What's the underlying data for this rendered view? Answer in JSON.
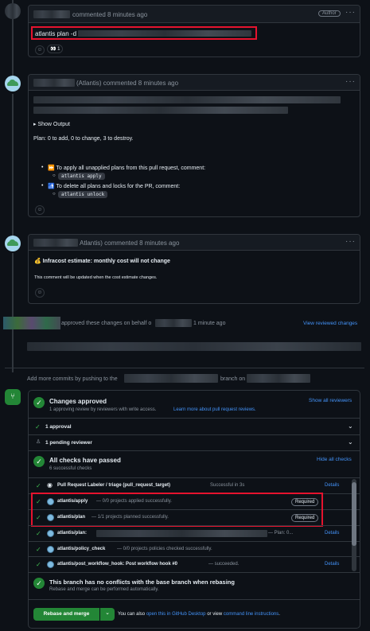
{
  "comment1": {
    "header_suffix": "commented 8 minutes ago",
    "author_badge": "Author",
    "body_prefix": "atlantis plan -d",
    "reaction_count": "1"
  },
  "comment2": {
    "header_suffix": "(Atlantis) commented 8 minutes ago",
    "show_output": "▸ Show Output",
    "plan_summary": "Plan: 0 to add, 0 to change, 3 to destroy.",
    "bullet1": "⏩ To apply all unapplied plans from this pull request, comment:",
    "code1": "atlantis apply",
    "bullet2": "🚮 To delete all plans and locks for the PR, comment:",
    "code2": "atlantis unlock"
  },
  "comment3": {
    "header_suffix": "Atlantis) commented 8 minutes ago",
    "estimate": "💰 Infracost estimate: monthly cost will not change",
    "note": "This comment will be updated when the cost estimate changes."
  },
  "approval_event": {
    "text_a": "approved these changes on behalf o",
    "text_b": "1 minute ago",
    "link": "View reviewed changes"
  },
  "push_hint": {
    "prefix": "Add more commits by pushing to the",
    "middle": "branch on"
  },
  "merge_box": {
    "approved": {
      "title": "Changes approved",
      "desc": "1 approving review by reviewers with write access.",
      "desc_link": "Learn more about pull request reviews.",
      "show_all": "Show all reviewers"
    },
    "approval_row": "1 approval",
    "pending_row": "1 pending reviewer",
    "checks": {
      "title": "All checks have passed",
      "desc": "6 successful checks",
      "hide_all": "Hide all checks"
    },
    "check_rows": [
      {
        "name": "Pull Request Labeler / triage (pull_request_target)",
        "status": "Successful in 3s",
        "details": "Details"
      },
      {
        "name": "atlantis/apply",
        "status": "— 0/0 projects applied successfully.",
        "required": "Required"
      },
      {
        "name": "atlantis/plan",
        "status": "— 1/1 projects planned successfully.",
        "required": "Required"
      },
      {
        "name": "atlantis/plan:",
        "status": "— Plan: 0...",
        "details": "Details"
      },
      {
        "name": "atlantis/policy_check",
        "status": "— 0/0 projects policies checked successfully."
      },
      {
        "name": "atlantis/post_workflow_hook: Post workflow hook #0",
        "status": "— succeeded.",
        "details": "Details"
      }
    ],
    "no_conflicts": {
      "title": "This branch has no conflicts with the base branch when rebasing",
      "desc": "Rebase and merge can be performed automatically."
    },
    "merge_button": "Rebase and merge",
    "footer_prefix": "You can also",
    "footer_link1": "open this in GitHub Desktop",
    "footer_mid": "or view",
    "footer_link2": "command line instructions",
    "footer_end": "."
  },
  "colors": {
    "accent": "#4493f8",
    "success": "#238636",
    "highlight": "#e5132e"
  }
}
